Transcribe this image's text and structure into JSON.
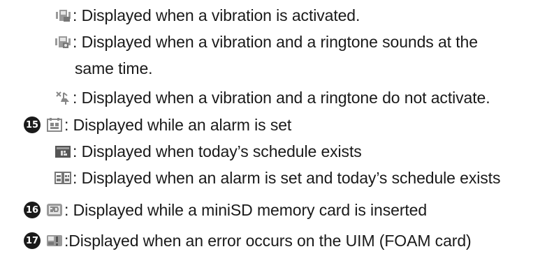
{
  "lines": [
    {
      "text": ": Displayed when a vibration is activated.",
      "icon": "vibration-icon"
    },
    {
      "text": ": Displayed when a vibration and a ringtone sounds at the",
      "icon": "vibration-ringtone-icon"
    },
    {
      "text": "same time."
    },
    {
      "text": ": Displayed when a vibration and a ringtone do not activate.",
      "icon": "silent-icon"
    },
    {
      "num": "15",
      "text": ": Displayed while an alarm is set",
      "icon": "alarm-icon"
    },
    {
      "text": ": Displayed when today’s schedule exists",
      "icon": "schedule-icon"
    },
    {
      "text": ": Displayed when an alarm is set and today’s schedule exists",
      "icon": "alarm-schedule-icon"
    },
    {
      "num": "16",
      "text": ": Displayed while a miniSD memory card is inserted",
      "icon": "minisd-icon"
    },
    {
      "num": "17",
      "text": ":Displayed when an error occurs on the UIM (FOAM card)",
      "icon": "uim-error-icon"
    }
  ]
}
